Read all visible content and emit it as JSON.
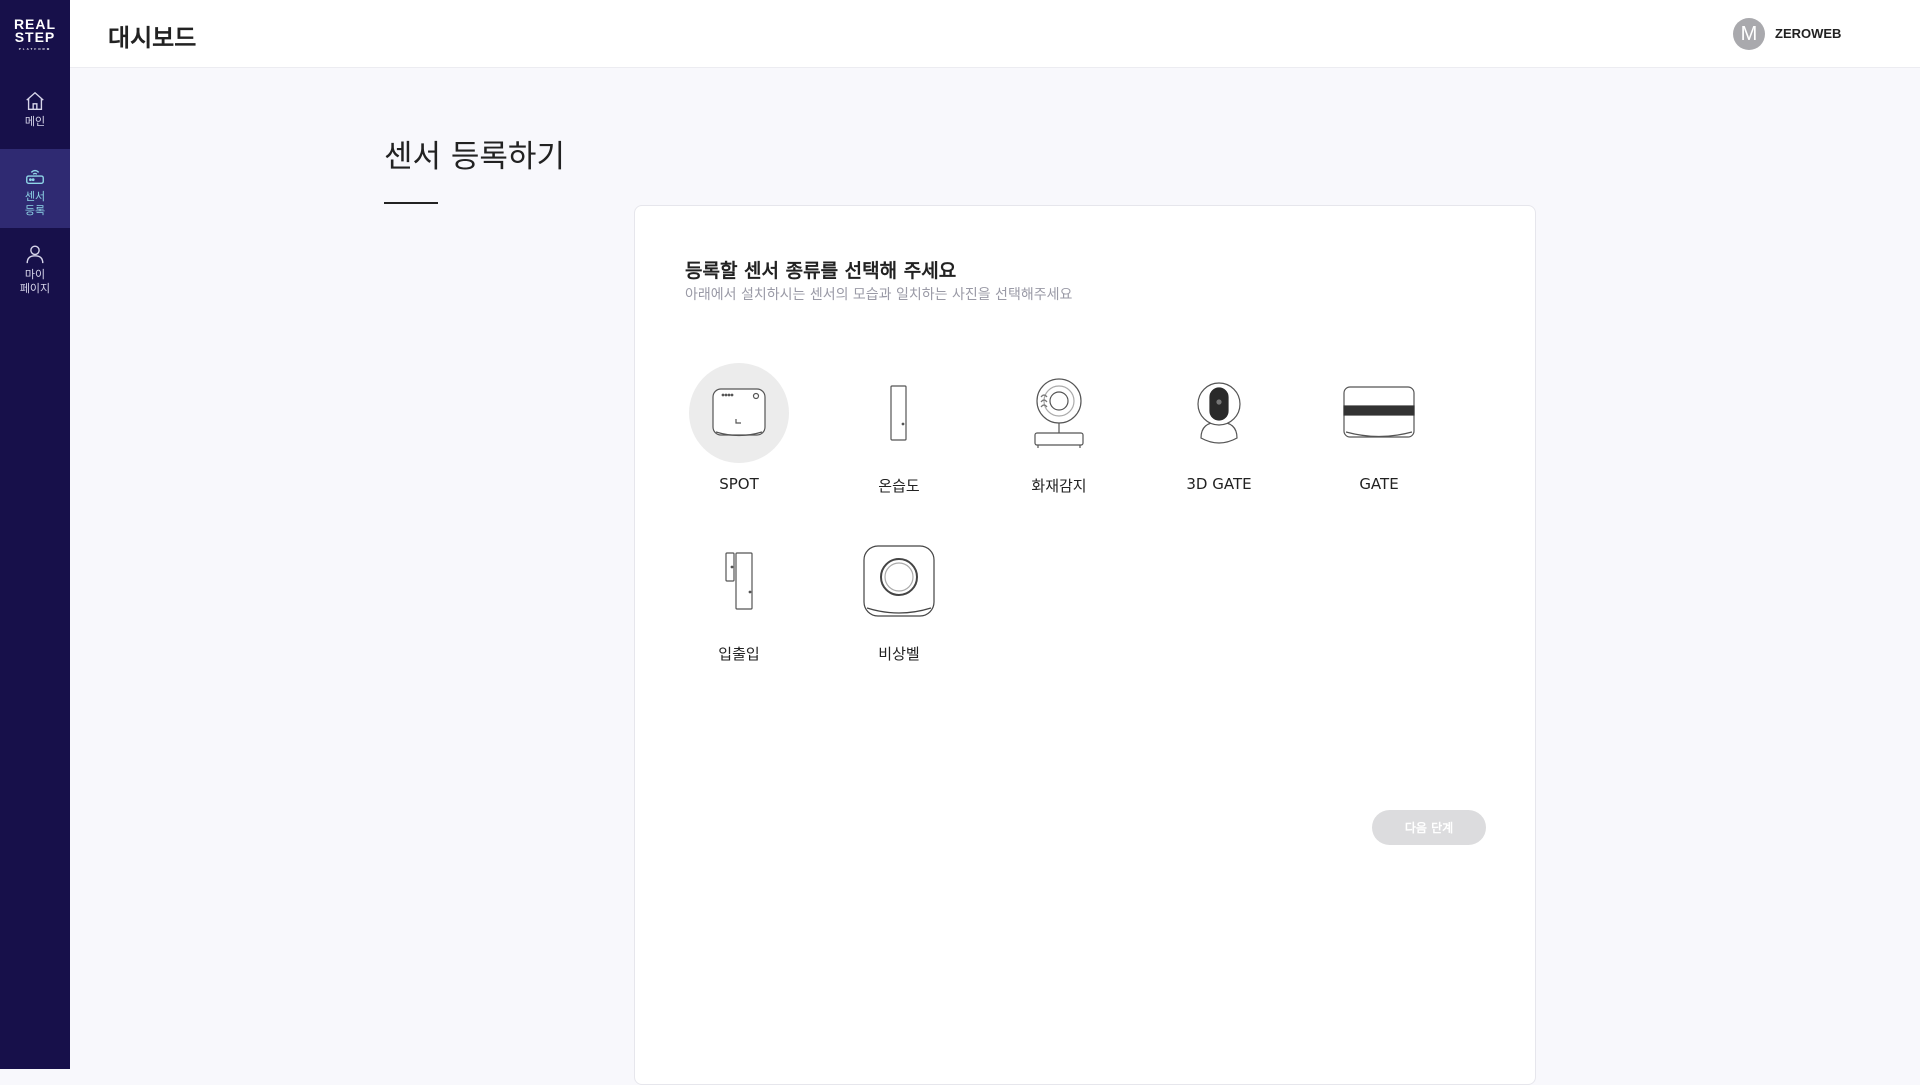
{
  "app": {
    "logo_line1": "REAL",
    "logo_line2": "STEP",
    "logo_line3": "PLATFORM"
  },
  "sidebar": {
    "items": [
      {
        "label": "메인",
        "icon": "home-icon"
      },
      {
        "label": "센서\n등록",
        "icon": "router-icon",
        "active": true
      },
      {
        "label": "마이\n페이지",
        "icon": "user-icon"
      }
    ]
  },
  "header": {
    "title": "대시보드",
    "avatar_letter": "M",
    "username": "ZEROWEB"
  },
  "page": {
    "title": "센서 등록하기"
  },
  "card": {
    "title": "등록할 센서 종류를 선택해 주세요",
    "subtitle": "아래에서 설치하시는 센서의 모습과 일치하는 사진을 선택해주세요",
    "sensors": [
      {
        "label": "SPOT",
        "icon": "spot-sensor-icon",
        "selected": true
      },
      {
        "label": "온습도",
        "icon": "humidity-sensor-icon"
      },
      {
        "label": "화재감지",
        "icon": "fire-sensor-icon"
      },
      {
        "label": "3D GATE",
        "icon": "3d-gate-camera-icon"
      },
      {
        "label": "GATE",
        "icon": "gate-sensor-icon"
      },
      {
        "label": "입출입",
        "icon": "door-sensor-icon"
      },
      {
        "label": "비상벨",
        "icon": "emergency-bell-icon"
      }
    ],
    "next_button": "다음 단계"
  },
  "colors": {
    "sidebar_bg": "#17104a",
    "sidebar_active_bg": "#2f2a72",
    "sidebar_active_text": "#8fd6e8",
    "button_disabled": "#dcdcde"
  }
}
